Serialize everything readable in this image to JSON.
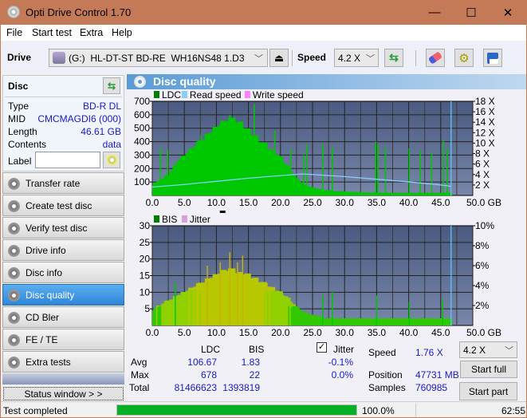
{
  "window": {
    "title": "Opti Drive Control 1.70",
    "minimize": "—",
    "maximize": "☐",
    "close": "✕"
  },
  "menu": [
    {
      "label": "File"
    },
    {
      "label": "Start test"
    },
    {
      "label": "Extra"
    },
    {
      "label": "Help"
    }
  ],
  "toolbar": {
    "drive_label": "Drive",
    "drive_value": "(G:)  HL-DT-ST BD-RE  WH16NS48 1.D3",
    "speed_label": "Speed",
    "speed_value": "4.2 X"
  },
  "disc": {
    "header": "Disc",
    "rows": [
      {
        "label": "Type",
        "value": "BD-R DL"
      },
      {
        "label": "MID",
        "value": "CMCMAGDI6 (000)"
      },
      {
        "label": "Length",
        "value": "46.61 GB"
      },
      {
        "label": "Contents",
        "value": "data"
      }
    ],
    "label_field_label": "Label",
    "label_field_value": ""
  },
  "nav": [
    {
      "label": "Transfer rate",
      "active": false
    },
    {
      "label": "Create test disc",
      "active": false
    },
    {
      "label": "Verify test disc",
      "active": false
    },
    {
      "label": "Drive info",
      "active": false
    },
    {
      "label": "Disc info",
      "active": false
    },
    {
      "label": "Disc quality",
      "active": true
    },
    {
      "label": "CD Bler",
      "active": false
    },
    {
      "label": "FE / TE",
      "active": false
    },
    {
      "label": "Extra tests",
      "active": false
    }
  ],
  "status_window_button": "Status window > >",
  "panel_title": "Disc quality",
  "chart_data": [
    {
      "type": "bar",
      "title": "LDC / Read speed",
      "legend": [
        {
          "name": "LDC",
          "color": "#008000"
        },
        {
          "name": "Read speed",
          "color": "#87cefa"
        },
        {
          "name": "Write speed",
          "color": "#ff80ff"
        }
      ],
      "xlabel": "GB",
      "xlim": [
        0,
        50
      ],
      "x_ticks": [
        "0.0",
        "5.0",
        "10.0",
        "15.0",
        "20.0",
        "25.0",
        "30.0",
        "35.0",
        "40.0",
        "45.0",
        "50.0 GB"
      ],
      "ylim": [
        0,
        700
      ],
      "y_ticks": [
        "100",
        "200",
        "300",
        "400",
        "500",
        "600",
        "700"
      ],
      "y2lim": [
        0,
        18
      ],
      "y2_ticks": [
        "2 X",
        "4 X",
        "6 X",
        "8 X",
        "10 X",
        "12 X",
        "14 X",
        "16 X",
        "18 X"
      ],
      "grid": true,
      "end_marker_gb": 46.61,
      "series": [
        {
          "name": "LDC",
          "x": [
            0,
            1,
            2,
            3,
            4,
            5,
            6,
            7,
            8,
            9,
            10,
            11,
            12,
            13,
            14,
            15,
            16,
            17,
            18,
            19,
            20,
            21,
            22,
            23,
            24,
            25,
            26,
            27,
            28,
            29,
            30,
            31,
            32,
            33,
            34,
            35,
            36,
            37,
            38,
            39,
            40,
            41,
            42,
            43,
            44,
            45,
            46
          ],
          "values": [
            90,
            110,
            140,
            200,
            260,
            300,
            340,
            380,
            420,
            460,
            500,
            530,
            540,
            520,
            480,
            440,
            400,
            360,
            320,
            290,
            240,
            170,
            110,
            80,
            60,
            50,
            40,
            35,
            30,
            30,
            25,
            25,
            22,
            20,
            20,
            20,
            18,
            18,
            18,
            18,
            18,
            18,
            18,
            18,
            18,
            18,
            20
          ]
        },
        {
          "name": "LDC spikes",
          "x": [
            1.2,
            2.3,
            7.5,
            12.0,
            15.8,
            19.0,
            21.5,
            23.5,
            24.0,
            26.5,
            28.0,
            34.8,
            35.1,
            36.3,
            40.0,
            41.7,
            43.5,
            45.3,
            45.9
          ],
          "values": [
            350,
            340,
            450,
            600,
            678,
            480,
            350,
            300,
            380,
            380,
            360,
            400,
            380,
            360,
            350,
            330,
            320,
            410,
            350
          ]
        },
        {
          "name": "Read speed",
          "x": [
            0,
            5,
            10,
            15,
            20,
            23.3,
            25,
            30,
            35,
            40,
            45,
            46.61
          ],
          "values": [
            1.6,
            2.1,
            2.7,
            3.3,
            3.8,
            4.1,
            4.0,
            3.6,
            3.1,
            2.6,
            2.0,
            1.76
          ]
        }
      ]
    },
    {
      "type": "bar",
      "title": "BIS / Jitter",
      "legend": [
        {
          "name": "BIS",
          "color": "#008000"
        },
        {
          "name": "Jitter",
          "color": "#d8a0d8"
        }
      ],
      "xlabel": "GB",
      "xlim": [
        0,
        50
      ],
      "x_ticks": [
        "0.0",
        "5.0",
        "10.0",
        "15.0",
        "20.0",
        "25.0",
        "30.0",
        "35.0",
        "40.0",
        "45.0",
        "50.0 GB"
      ],
      "ylim": [
        0,
        30
      ],
      "y_ticks": [
        "5",
        "10",
        "15",
        "20",
        "25",
        "30"
      ],
      "y2lim": [
        0,
        10
      ],
      "y2_ticks": [
        "2%",
        "4%",
        "6%",
        "8%",
        "10%"
      ],
      "grid": true,
      "end_marker_gb": 46.61,
      "series": [
        {
          "name": "BIS",
          "x": [
            0,
            1,
            2,
            3,
            4,
            5,
            6,
            7,
            8,
            9,
            10,
            11,
            12,
            13,
            14,
            15,
            16,
            17,
            18,
            19,
            20,
            21,
            22,
            23,
            24,
            25,
            26,
            27,
            28,
            29,
            30,
            31,
            32,
            33,
            34,
            35,
            36,
            37,
            38,
            39,
            40,
            41,
            42,
            43,
            44,
            45,
            46
          ],
          "values": [
            5,
            6,
            7,
            8,
            9,
            10,
            11,
            12,
            13,
            14,
            15,
            16,
            16,
            15,
            15,
            14,
            13,
            12,
            11,
            10,
            9,
            7,
            5,
            4,
            3,
            3,
            2,
            2,
            2,
            2,
            2,
            2,
            2,
            2,
            2,
            2,
            2,
            2,
            2,
            2,
            2,
            2,
            2,
            2,
            2,
            2,
            2
          ]
        },
        {
          "name": "BIS spikes",
          "x": [
            3.5,
            8.5,
            10.5,
            12.0,
            13.2,
            14.0,
            26.5,
            28.0,
            34.9,
            40.0,
            45.2
          ],
          "values": [
            13,
            18,
            19,
            22,
            19,
            21,
            9,
            10,
            9,
            7,
            8
          ]
        }
      ]
    }
  ],
  "stats": {
    "col_ldc": "LDC",
    "col_bis": "BIS",
    "jitter_label": "Jitter",
    "jitter_checked": true,
    "rows": [
      {
        "label": "Avg",
        "ldc": "106.67",
        "bis": "1.83",
        "jitter": "-0.1%"
      },
      {
        "label": "Max",
        "ldc": "678",
        "bis": "22",
        "jitter": "0.0%"
      },
      {
        "label": "Total",
        "ldc": "81466623",
        "bis": "1393819",
        "jitter": ""
      }
    ],
    "speed_label": "Speed",
    "speed_value": "1.76 X",
    "speed_select": "4.2 X",
    "position_label": "Position",
    "position_value": "47731 MB",
    "samples_label": "Samples",
    "samples_value": "760985",
    "start_full": "Start full",
    "start_part": "Start part"
  },
  "statusbar": {
    "text": "Test completed",
    "progress": 100.0,
    "progress_text": "100.0%",
    "time": "62:55"
  }
}
